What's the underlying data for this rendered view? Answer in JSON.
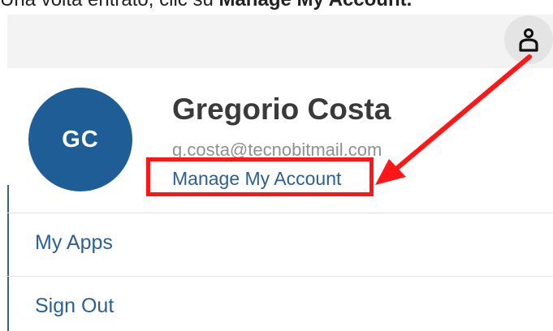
{
  "caption": {
    "prefix": "Una volta entrato, clic su ",
    "bold": "Manage My Account."
  },
  "header": {
    "user_icon": "person-outline-icon"
  },
  "profile": {
    "initials": "GC",
    "name": "Gregorio Costa",
    "email": "g.costa@tecnobitmail.com",
    "manage_link": "Manage My Account"
  },
  "menu": {
    "items": [
      {
        "label": "My Apps"
      },
      {
        "label": "Sign Out"
      }
    ]
  },
  "annotation": {
    "color": "#ff1616"
  }
}
